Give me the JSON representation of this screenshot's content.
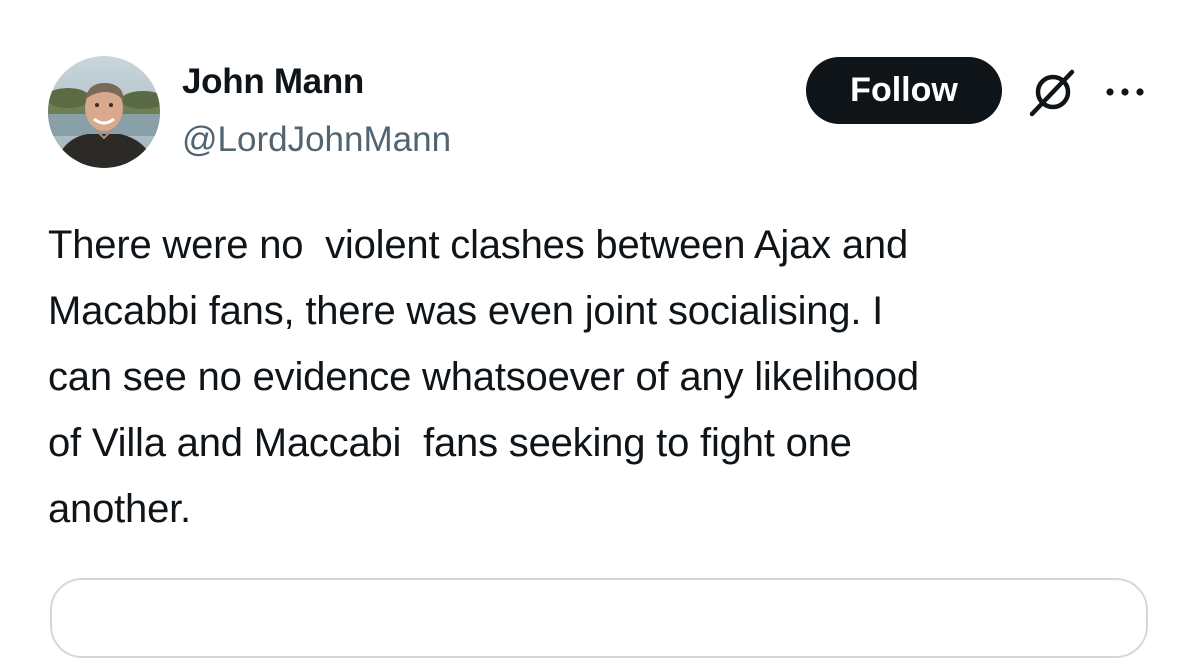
{
  "author": {
    "name": "John Mann",
    "handle": "@LordJohnMann"
  },
  "actions": {
    "follow_label": "Follow",
    "grok_icon": "grok-slash-circle-icon",
    "more_icon": "more-dots-icon"
  },
  "tweet": {
    "text": "There were no  violent clashes between Ajax and\nMacabbi fans, there was even joint socialising. I\ncan see no evidence whatsoever of any likelihood\nof Villa and Maccabi  fans seeking to fight one\nanother."
  },
  "colors": {
    "text": "#0f1419",
    "secondary": "#536471",
    "button_bg": "#0f1419",
    "border": "#cfd9de"
  }
}
